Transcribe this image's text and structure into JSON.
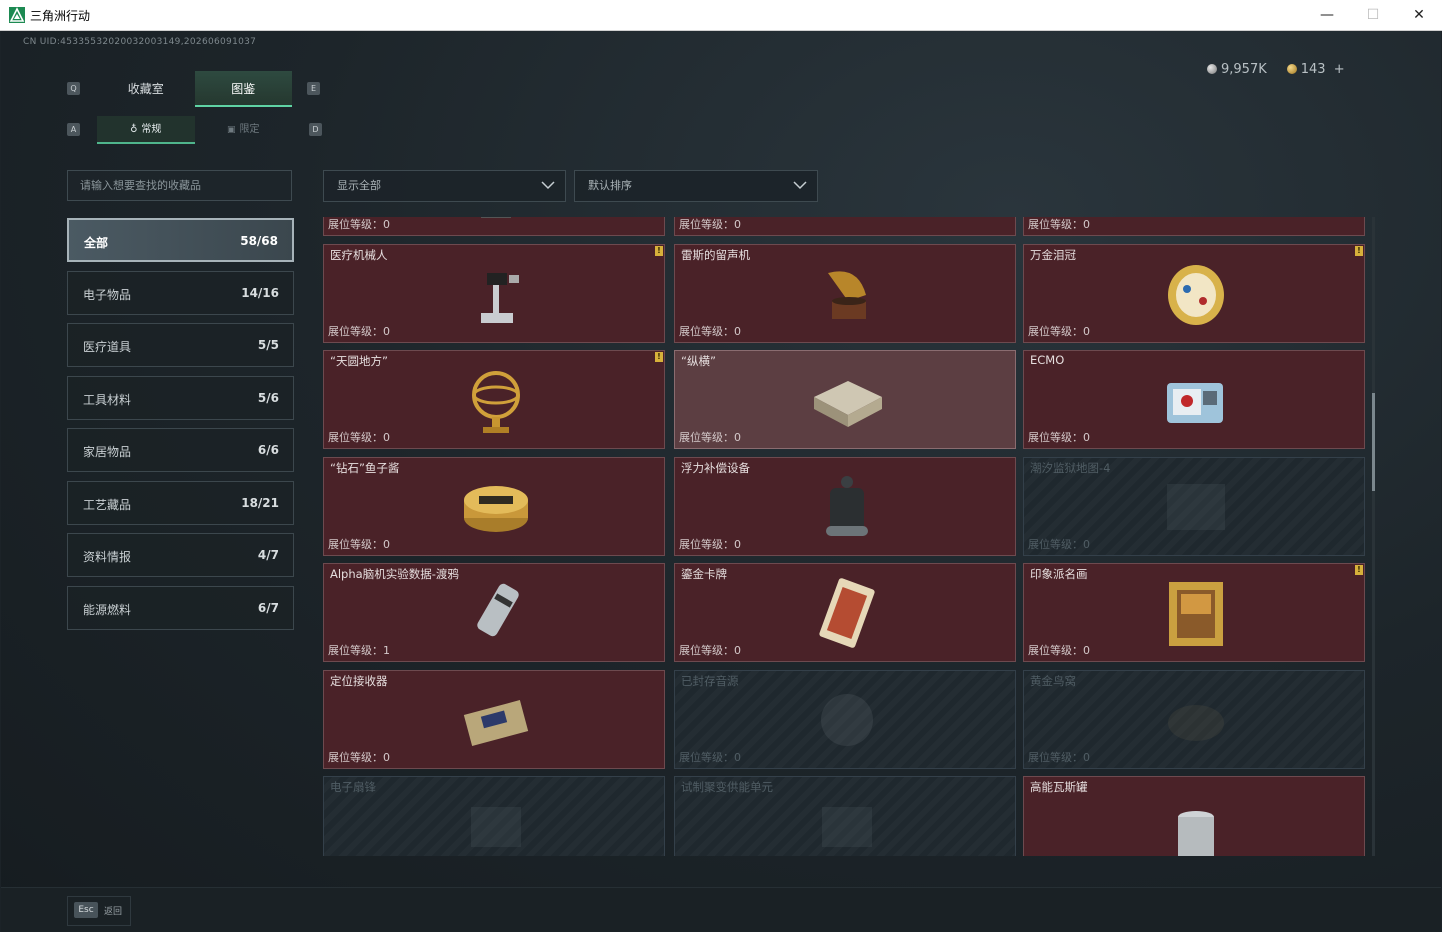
{
  "window": {
    "title": "三角洲行动",
    "min": "—",
    "max": "☐",
    "close": "✕"
  },
  "header": {
    "uid": "CN UID:4533553202003200314​9,202606091037",
    "silver": "9,957K",
    "gold": "143",
    "plus": "+"
  },
  "keys": {
    "q": "Q",
    "e": "E",
    "a": "A",
    "d": "D"
  },
  "tabs_main": [
    "收藏室",
    "图鉴"
  ],
  "tabs_sub": [
    "常规",
    "限定"
  ],
  "search": {
    "placeholder": "请输入想要查找的收藏品"
  },
  "filter": {
    "value": "显示全部"
  },
  "sort": {
    "value": "默认排序"
  },
  "categories": [
    {
      "label": "全部",
      "count": "58/68"
    },
    {
      "label": "电子物品",
      "count": "14/16"
    },
    {
      "label": "医疗道具",
      "count": "5/5"
    },
    {
      "label": "工具材料",
      "count": "5/6"
    },
    {
      "label": "家居物品",
      "count": "6/6"
    },
    {
      "label": "工艺藏品",
      "count": "18/21"
    },
    {
      "label": "资料情报",
      "count": "4/7"
    },
    {
      "label": "能源燃料",
      "count": "6/7"
    }
  ],
  "cards": [
    {
      "name": "",
      "level": "展位等级：0",
      "state": "unlocked",
      "icon": "generator-icon",
      "badge": ""
    },
    {
      "name": "",
      "level": "展位等级：0",
      "state": "unlocked",
      "icon": "server-rack-icon",
      "badge": ""
    },
    {
      "name": "",
      "level": "展位等级：0",
      "state": "unlocked",
      "icon": "battery-pack-icon",
      "badge": ""
    },
    {
      "name": "医疗机械人",
      "level": "展位等级：0",
      "state": "unlocked",
      "icon": "medical-robot-icon",
      "badge": "!"
    },
    {
      "name": "雷斯的留声机",
      "level": "展位等级：0",
      "state": "unlocked",
      "icon": "gramophone-icon",
      "badge": ""
    },
    {
      "name": "万金泪冠",
      "level": "展位等级：0",
      "state": "unlocked",
      "icon": "jeweled-crown-icon",
      "badge": "!"
    },
    {
      "name": "“天圆地方”",
      "level": "展位等级：0",
      "state": "unlocked",
      "icon": "armillary-sphere-icon",
      "badge": "!"
    },
    {
      "name": "“纵横”",
      "level": "展位等级：0",
      "state": "highlight",
      "icon": "chess-box-icon",
      "badge": ""
    },
    {
      "name": "ECMO",
      "level": "展位等级：0",
      "state": "unlocked",
      "icon": "ecmo-machine-icon",
      "badge": ""
    },
    {
      "name": "“钻石”鱼子酱",
      "level": "展位等级：0",
      "state": "unlocked",
      "icon": "caviar-tin-icon",
      "badge": ""
    },
    {
      "name": "浮力补偿设备",
      "level": "展位等级：0",
      "state": "unlocked",
      "icon": "buoyancy-device-icon",
      "badge": ""
    },
    {
      "name": "潮汐监狱地图-4",
      "level": "展位等级：0",
      "state": "locked",
      "icon": "map-icon",
      "badge": ""
    },
    {
      "name": "Alpha脑机实验数据-渡鸦",
      "level": "展位等级：1",
      "state": "unlocked",
      "icon": "data-canister-icon",
      "badge": ""
    },
    {
      "name": "鎏金卡牌",
      "level": "展位等级：0",
      "state": "unlocked",
      "icon": "gilded-card-icon",
      "badge": ""
    },
    {
      "name": "印象派名画",
      "level": "展位等级：0",
      "state": "unlocked",
      "icon": "framed-painting-icon",
      "badge": "!"
    },
    {
      "name": "定位接收器",
      "level": "展位等级：0",
      "state": "unlocked",
      "icon": "locator-receiver-icon",
      "badge": ""
    },
    {
      "name": "已封存音源",
      "level": "展位等级：0",
      "state": "locked",
      "icon": "sealed-audio-icon",
      "badge": ""
    },
    {
      "name": "黄金鸟窝",
      "level": "展位等级：0",
      "state": "locked",
      "icon": "golden-nest-icon",
      "badge": ""
    },
    {
      "name": "电子扇锋",
      "level": "",
      "state": "locked",
      "icon": "electronic-item-icon",
      "badge": ""
    },
    {
      "name": "试制聚变供能单元",
      "level": "",
      "state": "locked",
      "icon": "fusion-unit-icon",
      "badge": ""
    },
    {
      "name": "高能瓦斯罐",
      "level": "",
      "state": "unlocked",
      "icon": "gas-canister-icon",
      "badge": ""
    }
  ],
  "footer": {
    "esc_key": "Esc",
    "esc_label": "返回"
  },
  "colors": {
    "accent": "#5fd3a4",
    "card_bg": "#4a2228",
    "badge": "#d7b13b"
  }
}
